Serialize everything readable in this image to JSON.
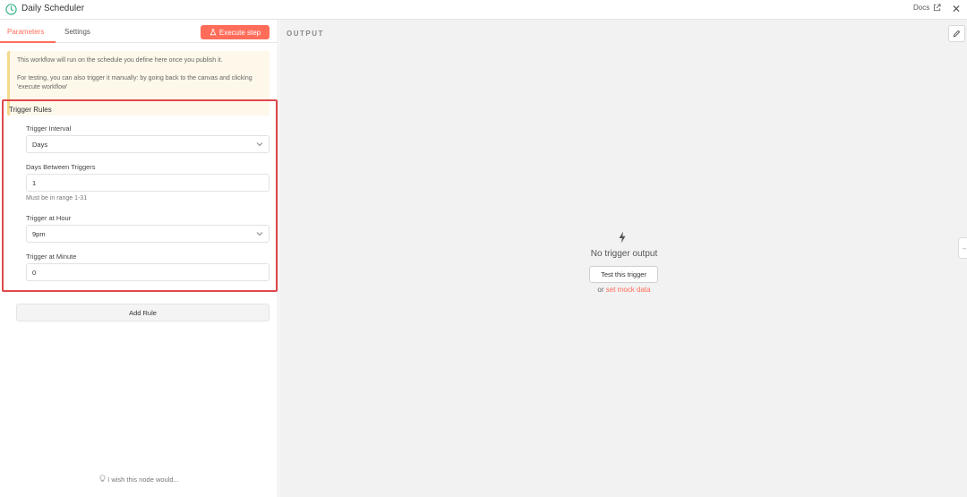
{
  "header": {
    "title": "Daily Scheduler",
    "docs_label": "Docs",
    "close_label": "✕"
  },
  "tabs": [
    {
      "label": "Parameters",
      "active": true
    },
    {
      "label": "Settings",
      "active": false
    }
  ],
  "execute_button": {
    "label": "Execute step"
  },
  "notice": {
    "line1": "This workflow will run on the schedule you define here once you publish it.",
    "line2": "For testing, you can also trigger it manually: by going back to the canvas and clicking 'execute workflow'"
  },
  "trigger_rules": {
    "title": "Trigger Rules",
    "interval_label": "Trigger Interval",
    "interval_value": "Days",
    "days_label": "Days Between Triggers",
    "days_value": "1",
    "days_hint": "Must be in range 1-31",
    "hour_label": "Trigger at Hour",
    "hour_value": "9pm",
    "minute_label": "Trigger at Minute",
    "minute_value": "0"
  },
  "add_rule": {
    "label": "Add Rule"
  },
  "feedback": {
    "label": "I wish this node would..."
  },
  "output": {
    "title": "OUTPUT",
    "empty_title": "No trigger output",
    "test_button": "Test this trigger",
    "or_text": "or",
    "mock_link": "set mock data",
    "side_tab": "→"
  },
  "colors": {
    "accent": "#ff6d5a",
    "highlight_border": "#e0484d",
    "clock_icon": "#3fb68b"
  }
}
